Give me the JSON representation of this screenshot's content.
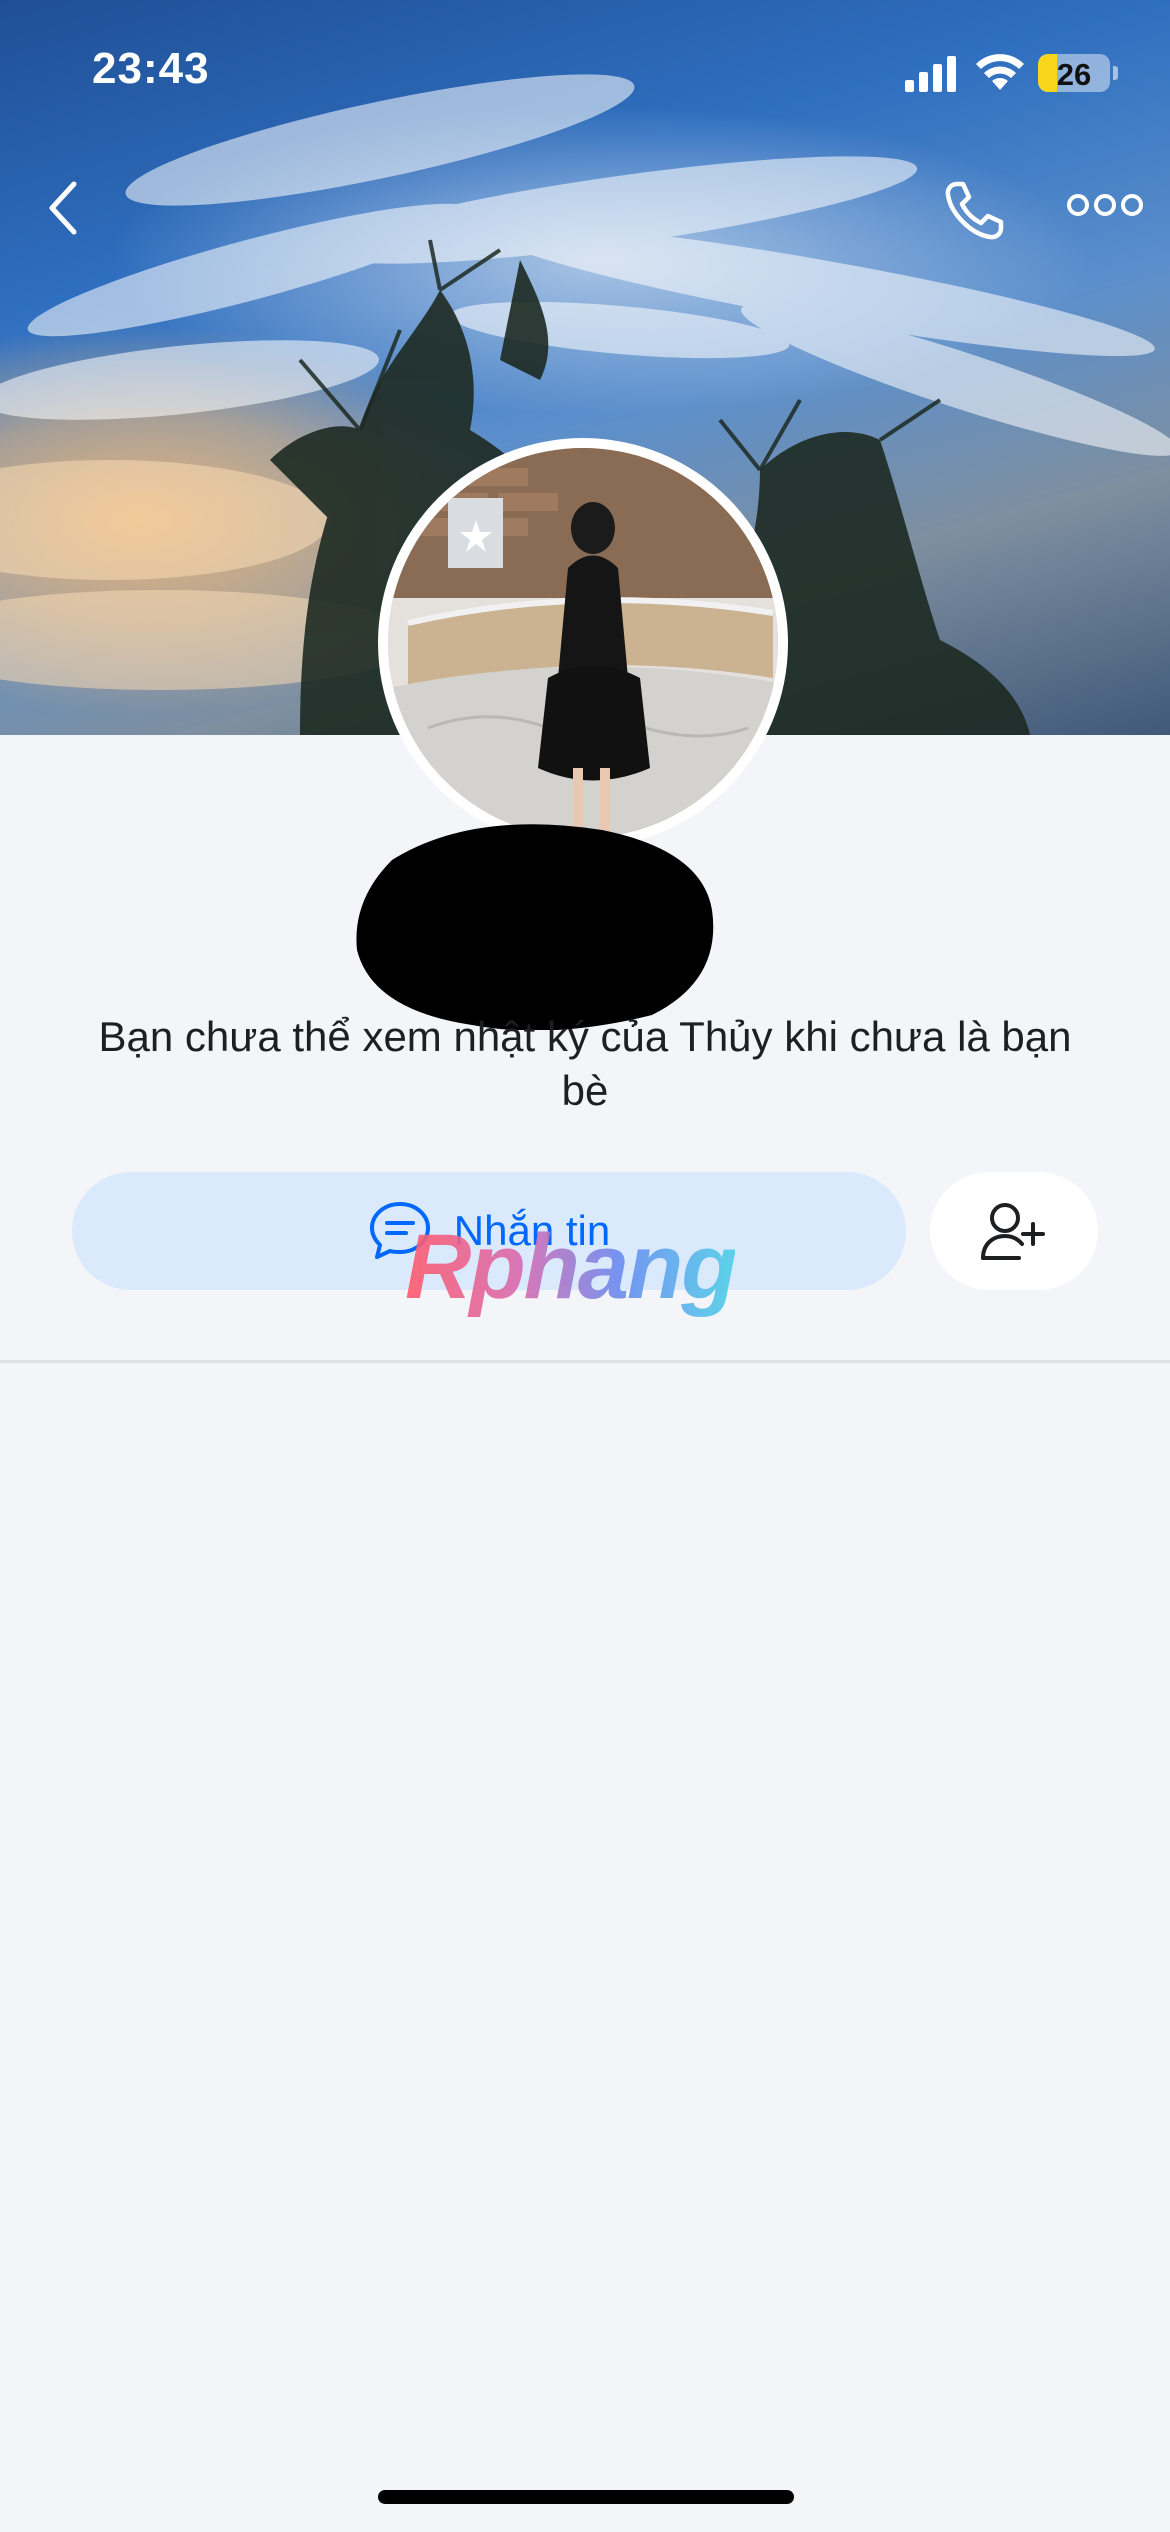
{
  "status_bar": {
    "time": "23:43",
    "battery_level": "26",
    "battery_fraction": 0.26,
    "battery_color": "#f7d61b",
    "icons": [
      "signal-icon",
      "wifi-icon",
      "battery-icon"
    ]
  },
  "header": {
    "icons": [
      "chevron-left-icon",
      "phone-icon",
      "more-horizontal-icon"
    ]
  },
  "profile": {
    "info_text": "Bạn chưa thể xem nhật ký của Thủy khi chưa là bạn bè"
  },
  "actions": {
    "message_label": "Nhắn tin",
    "message_icon": "chat-bubble-icon",
    "add_friend_icon": "add-friend-icon",
    "accent_color": "#0068ff"
  },
  "watermark": {
    "text": "Rphang"
  }
}
